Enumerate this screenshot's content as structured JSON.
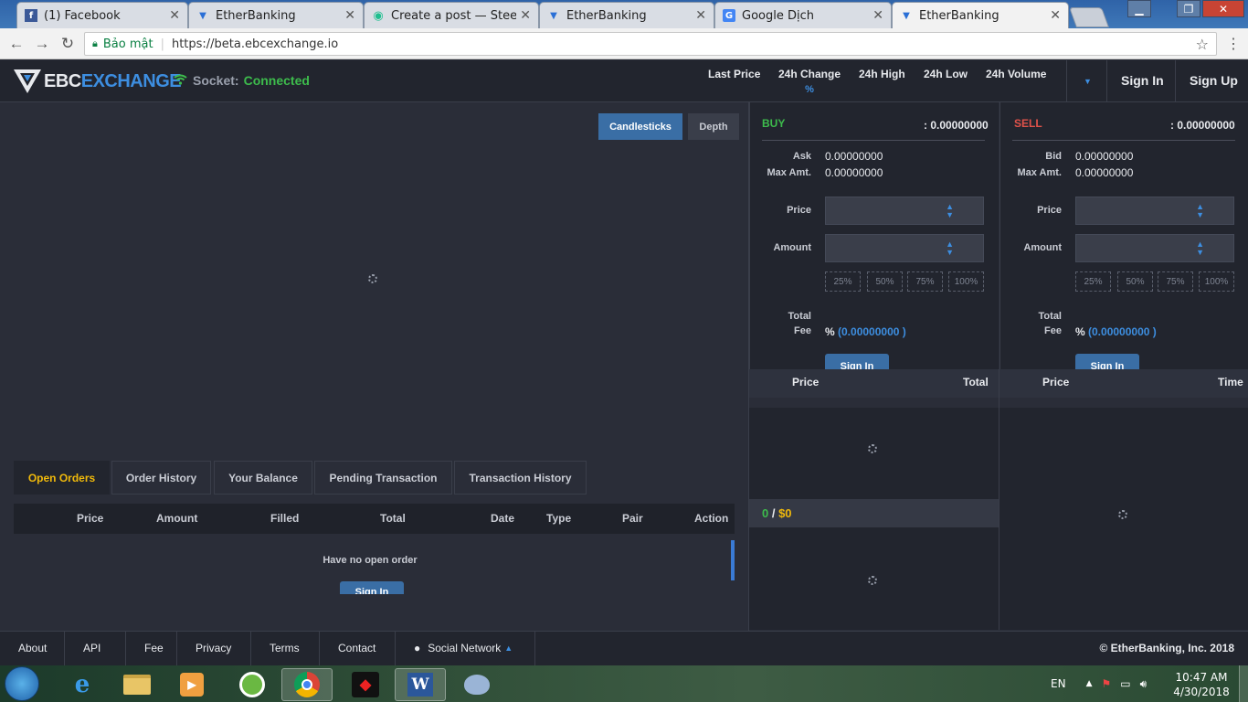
{
  "browser": {
    "tabs": [
      {
        "title": "(1) Facebook",
        "icon": "facebook-icon",
        "color": "#3b5998",
        "glyph": "f"
      },
      {
        "title": "EtherBanking",
        "icon": "etherbanking-icon",
        "color": "#2a6fd6",
        "glyph": "▼"
      },
      {
        "title": "Create a post — Steemit",
        "icon": "steemit-icon",
        "color": "#1fbf8f",
        "glyph": "◉"
      },
      {
        "title": "EtherBanking",
        "icon": "etherbanking-icon",
        "color": "#2a6fd6",
        "glyph": "▼"
      },
      {
        "title": "Google Dịch",
        "icon": "google-translate-icon",
        "color": "#4285f4",
        "glyph": "G"
      },
      {
        "title": "EtherBanking",
        "icon": "etherbanking-icon",
        "color": "#2a6fd6",
        "glyph": "▼"
      }
    ],
    "secure_label": "Bảo mật",
    "url": "https://beta.ebcexchange.io"
  },
  "header": {
    "logo_part1": "EBC",
    "logo_part2": "EXCHANGE",
    "socket_label": "Socket:",
    "socket_status": "Connected",
    "stats": {
      "last_price": "Last Price",
      "change": "24h Change",
      "change_unit": "%",
      "high": "24h High",
      "low": "24h Low",
      "volume": "24h Volume"
    },
    "sign_in": "Sign In",
    "sign_up": "Sign Up"
  },
  "chart": {
    "candlesticks": "Candlesticks",
    "depth": "Depth"
  },
  "orders": {
    "tabs": [
      "Open Orders",
      "Order History",
      "Your Balance",
      "Pending Transaction",
      "Transaction History"
    ],
    "columns": [
      "Price",
      "Amount",
      "Filled",
      "Total",
      "Date",
      "Type",
      "Pair",
      "Action"
    ],
    "empty": "Have no open order",
    "sign_in": "Sign In"
  },
  "buy": {
    "title": "BUY",
    "balance": ": 0.00000000",
    "ask_label": "Ask",
    "ask_value": "0.00000000",
    "max_label": "Max Amt.",
    "max_value": "0.00000000",
    "price_label": "Price",
    "amount_label": "Amount",
    "pcts": [
      "25%",
      "50%",
      "75%",
      "100%"
    ],
    "total_label": "Total",
    "fee_label": "Fee",
    "fee_pct": "%",
    "fee_value": "(0.00000000 )",
    "sign_in": "Sign In"
  },
  "sell": {
    "title": "SELL",
    "balance": ": 0.00000000",
    "bid_label": "Bid",
    "bid_value": "0.00000000",
    "max_label": "Max Amt.",
    "max_value": "0.00000000",
    "price_label": "Price",
    "amount_label": "Amount",
    "pcts": [
      "25%",
      "50%",
      "75%",
      "100%"
    ],
    "total_label": "Total",
    "fee_label": "Fee",
    "fee_pct": "%",
    "fee_value": "(0.00000000 )",
    "sign_in": "Sign In"
  },
  "orderbook": {
    "left_price": "Price",
    "left_total": "Total",
    "right_price": "Price",
    "right_time": "Time",
    "mid_zero": "0",
    "mid_sep": " / ",
    "mid_usd": "$0"
  },
  "footer": {
    "links": [
      "About",
      "API",
      "Fee",
      "Privacy",
      "Terms",
      "Contact",
      "Social Network"
    ],
    "copyright": "© EtherBanking, Inc. 2018"
  },
  "taskbar": {
    "lang": "EN",
    "time": "10:47 AM",
    "date": "4/30/2018"
  },
  "colors": {
    "accent_blue": "#3d8ee0",
    "buy_green": "#3dbb4c",
    "sell_red": "#e0524a",
    "active_yellow": "#f0b90b"
  }
}
